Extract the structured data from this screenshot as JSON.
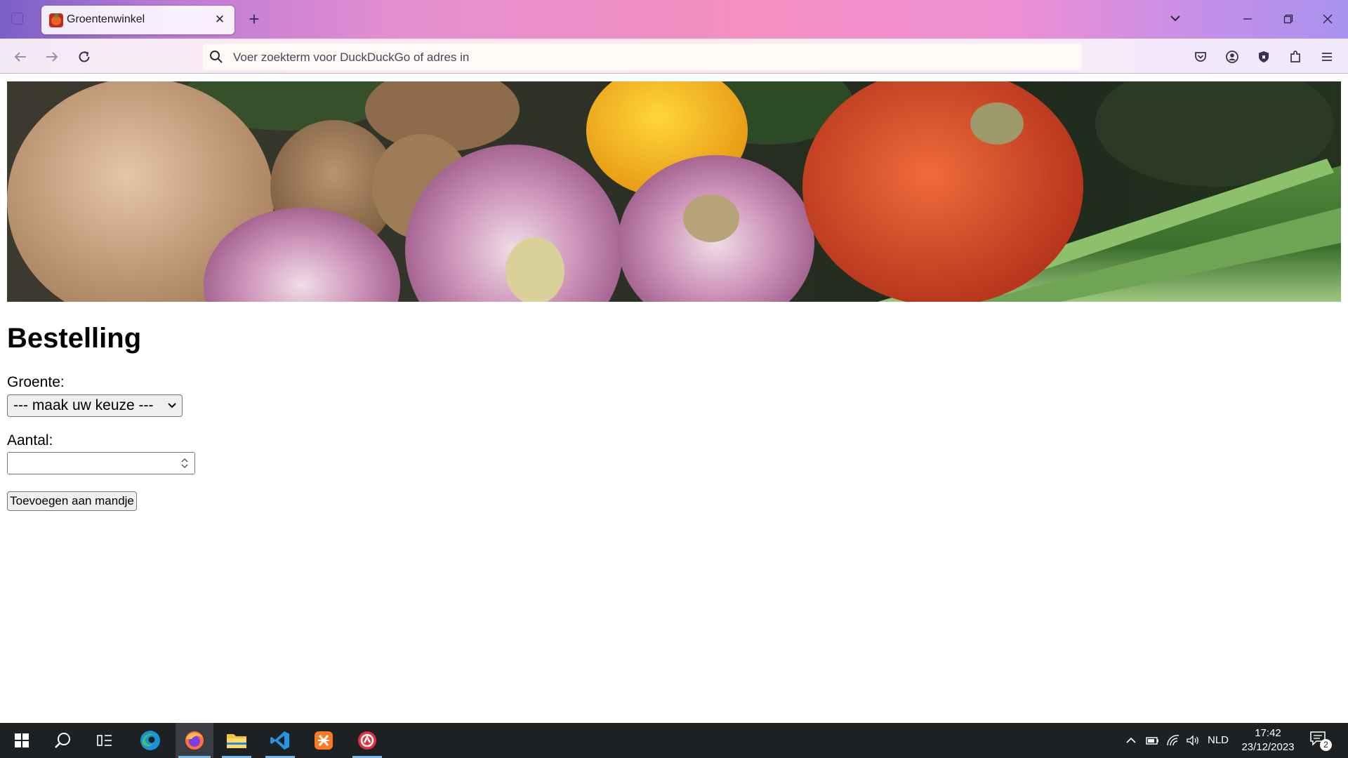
{
  "browser": {
    "tab": {
      "title": "Groentenwinkel",
      "favicon": "tomato-favicon"
    },
    "address_bar": {
      "placeholder": "Voer zoekterm voor DuckDuckGo of adres in",
      "value": ""
    },
    "toolbar_icons": [
      "pocket-icon",
      "account-icon",
      "shield-icon",
      "extensions-icon",
      "menu-icon"
    ]
  },
  "page": {
    "banner": {
      "subject": "vegetables"
    },
    "heading": "Bestelling",
    "vegetable_field": {
      "label": "Groente:",
      "selected": "--- maak uw keuze ---"
    },
    "quantity_field": {
      "label": "Aantal:",
      "value": ""
    },
    "add_button": "Toevoegen aan mandje"
  },
  "taskbar": {
    "apps": [
      "windows-start",
      "search",
      "task-view",
      "edge",
      "firefox",
      "file-explorer",
      "vscode",
      "xampp",
      "app-red-logo"
    ],
    "active_app": "firefox",
    "tray": {
      "language": "NLD",
      "time": "17:42",
      "date": "23/12/2023",
      "notification_count": "2"
    }
  },
  "colors": {
    "tab_gradient_start": "#7b5fc8",
    "tab_gradient_mid": "#f48fc0",
    "taskbar": "#1e2123",
    "accent_underline": "#76b9ed"
  }
}
